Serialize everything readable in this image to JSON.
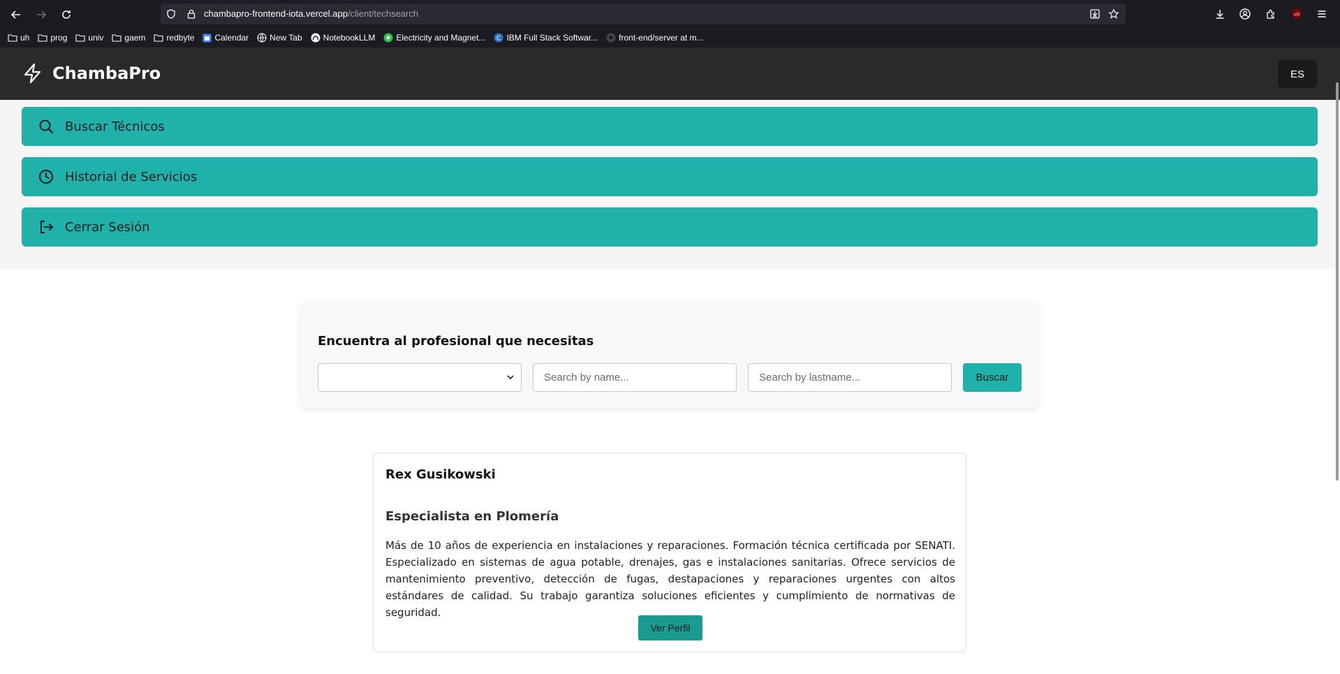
{
  "browser": {
    "url_host": "chambapro-frontend-iota.vercel.app",
    "url_path": "/client/techsearch",
    "bookmarks": [
      "uh",
      "prog",
      "univ",
      "gaem",
      "redbyte",
      "Calendar",
      "New Tab",
      "NotebookLLM",
      "Electricity and Magnet...",
      "IBM Full Stack Softwar...",
      "front-end/server at m..."
    ]
  },
  "header": {
    "brand": "ChambaPro",
    "lang": "ES"
  },
  "menu": {
    "search_label": "Buscar Técnicos",
    "history_label": "Historial de Servicios",
    "logout_label": "Cerrar Sesión"
  },
  "search": {
    "title": "Encuentra al profesional que necesitas",
    "category_value": "",
    "name_placeholder": "Search by name...",
    "lastname_placeholder": "Search by lastname...",
    "button_label": "Buscar"
  },
  "results": [
    {
      "name": "Rex Gusikowski",
      "specialty": "Especialista en Plomería",
      "description": "Más de 10 años de experiencia en instalaciones y reparaciones. Formación técnica certificada por SENATI. Especializado en sistemas de agua potable, drenajes, gas e instalaciones sanitarias. Ofrece servicios de mantenimiento preventivo, detección de fugas, destapaciones y reparaciones urgentes con altos estándares de calidad. Su trabajo garantiza soluciones eficientes y cumplimiento de normativas de seguridad.",
      "button_label": "Ver Perfil"
    }
  ],
  "colors": {
    "accent": "#20b2aa",
    "header_bg": "#2a2a2a",
    "profile_button": "#1a9b8f"
  }
}
